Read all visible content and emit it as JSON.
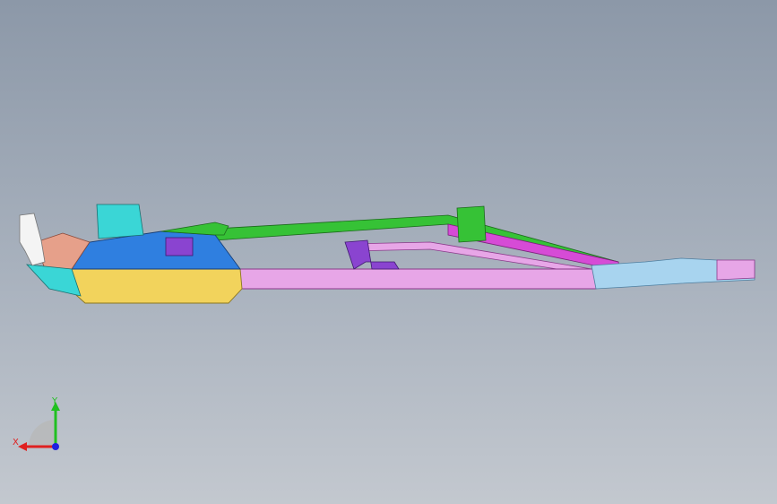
{
  "viewport": {
    "background_top": "#8c98a8",
    "background_bottom": "#c3c8cf"
  },
  "colors": {
    "yellow": "#f2d35c",
    "blue": "#2f7fe0",
    "cyan": "#3ad6d6",
    "green": "#36c236",
    "magenta": "#d64bd6",
    "pink_rail": "#e7a6e7",
    "purple": "#8a44d0",
    "light_blue": "#a8d4ef",
    "salmon": "#e6a08a",
    "white": "#f4f4f4"
  },
  "triad": {
    "x_label": "X",
    "y_label": "Y",
    "x_color": "#e02020",
    "y_color": "#20c020",
    "z_color": "#2020e0"
  }
}
